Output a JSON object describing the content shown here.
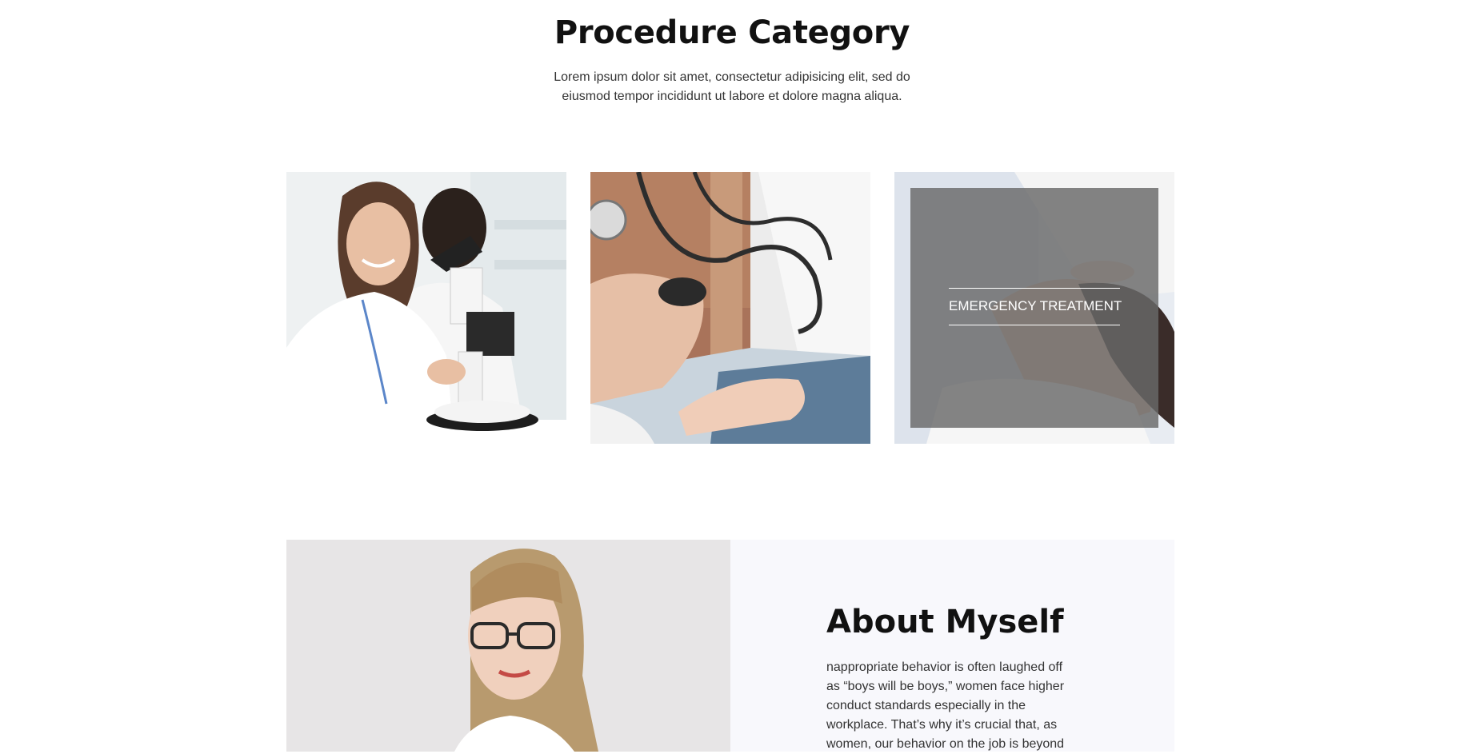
{
  "category": {
    "title": "Procedure Category",
    "intro": "Lorem ipsum dolor sit amet, consectetur adipisicing elit, sed do eiusmod tempor incididunt ut labore et dolore magna aliqua.",
    "cards": [
      {
        "image": "lab-microscope-image"
      },
      {
        "image": "blood-pressure-image"
      },
      {
        "image": "emergency-treatment-image",
        "label": "EMERGENCY TREATMENT"
      }
    ]
  },
  "about": {
    "title": "About Myself",
    "text": "nappropriate behavior is often laughed off as “boys will be boys,” women face higher conduct standards especially in the workplace. That’s why it’s crucial that, as women, our behavior on the job is beyond"
  },
  "colors": {
    "overlay": "#696969",
    "about_panel": "#f8f8fc"
  }
}
